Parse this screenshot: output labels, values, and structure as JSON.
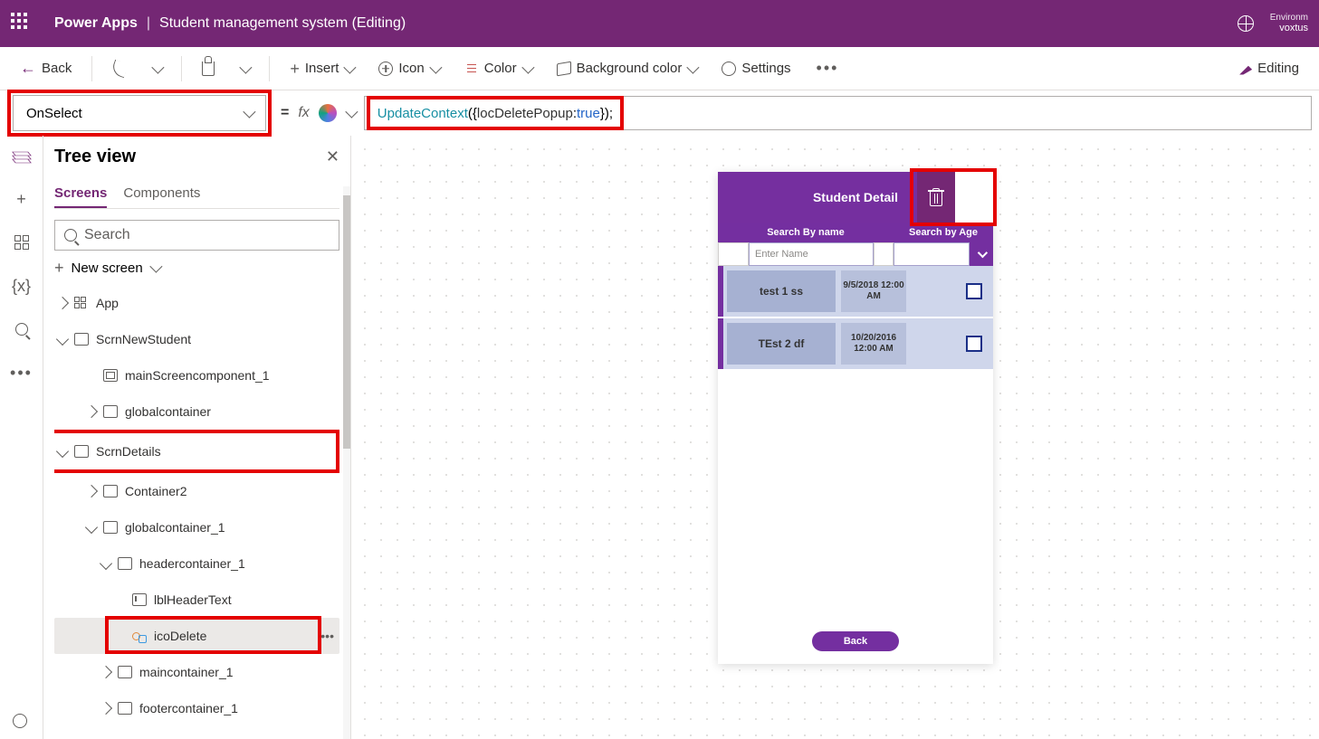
{
  "header": {
    "app": "Power Apps",
    "file": "Student management system (Editing)",
    "env_label": "Environm",
    "env_name": "voxtus"
  },
  "cmd": {
    "back": "Back",
    "insert": "Insert",
    "icon": "Icon",
    "color": "Color",
    "bgcolor": "Background color",
    "settings": "Settings",
    "editing": "Editing"
  },
  "formula": {
    "property": "OnSelect",
    "tokens": {
      "fn": "UpdateContext",
      "open": "({",
      "var": "locDeletePopup",
      "colon": ":",
      "val": "true",
      "close": "});"
    }
  },
  "tree": {
    "title": "Tree view",
    "tabs": {
      "screens": "Screens",
      "components": "Components"
    },
    "search_placeholder": "Search",
    "newscreen": "New screen",
    "items": {
      "app": "App",
      "scrnNew": "ScrnNewStudent",
      "mainComp": "mainScreencomponent_1",
      "globalC": "globalcontainer",
      "scrnDetails": "ScrnDetails",
      "container2": "Container2",
      "globalC1": "globalcontainer_1",
      "headerC1": "headercontainer_1",
      "lblHeader": "lblHeaderText",
      "icoDelete": "icoDelete",
      "mainC1": "maincontainer_1",
      "footerC1": "footercontainer_1"
    }
  },
  "preview": {
    "title": "Student Detail",
    "searchName": "Search By name",
    "searchAge": "Search by  Age",
    "placeholder": "Enter Name",
    "rows": [
      {
        "name": "test 1 ss",
        "date": "9/5/2018 12:00 AM"
      },
      {
        "name": "TEst 2 df",
        "date": "10/20/2016 12:00 AM"
      }
    ],
    "back": "Back"
  }
}
